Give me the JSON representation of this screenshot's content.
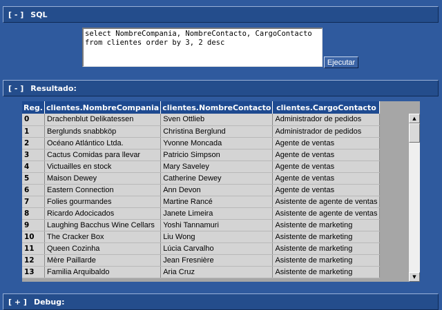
{
  "sql_section": {
    "toggle": "[ - ]",
    "title": "SQL",
    "query": "select NombreCompania, NombreContacto, CargoContacto\nfrom clientes order by 3, 2 desc",
    "execute_label": "Ejecutar"
  },
  "result_section": {
    "toggle": "[ - ]",
    "title": "Resultado:",
    "columns": [
      "Reg.",
      "clientes.NombreCompania",
      "clientes.NombreContacto",
      "clientes.CargoContacto"
    ],
    "rows": [
      [
        "0",
        "Drachenblut Delikatessen",
        "Sven Ottlieb",
        "Administrador de pedidos"
      ],
      [
        "1",
        "Berglunds snabbköp",
        "Christina Berglund",
        "Administrador de pedidos"
      ],
      [
        "2",
        "Océano Atlántico Ltda.",
        "Yvonne Moncada",
        "Agente de ventas"
      ],
      [
        "3",
        "Cactus Comidas para llevar",
        "Patricio Simpson",
        "Agente de ventas"
      ],
      [
        "4",
        "Victuailles en stock",
        "Mary Saveley",
        "Agente de ventas"
      ],
      [
        "5",
        "Maison Dewey",
        "Catherine Dewey",
        "Agente de ventas"
      ],
      [
        "6",
        "Eastern Connection",
        "Ann Devon",
        "Agente de ventas"
      ],
      [
        "7",
        "Folies gourmandes",
        "Martine Rancé",
        "Asistente de agente de ventas"
      ],
      [
        "8",
        "Ricardo Adocicados",
        "Janete Limeira",
        "Asistente de agente de ventas"
      ],
      [
        "9",
        "Laughing Bacchus Wine Cellars",
        "Yoshi Tannamuri",
        "Asistente de marketing"
      ],
      [
        "10",
        "The Cracker Box",
        "Liu Wong",
        "Asistente de marketing"
      ],
      [
        "11",
        "Queen Cozinha",
        "Lúcia Carvalho",
        "Asistente de marketing"
      ],
      [
        "12",
        "Mère Paillarde",
        "Jean Fresnière",
        "Asistente de marketing"
      ],
      [
        "13",
        "Familia Arquibaldo",
        "Aria Cruz",
        "Asistente de marketing"
      ]
    ]
  },
  "debug_section": {
    "toggle": "[ + ]",
    "title": "Debug:"
  },
  "scrollbar": {
    "up_icon": "▲",
    "down_icon": "▼"
  },
  "colors": {
    "background": "#2f5a9e",
    "header_bar": "#244d8c",
    "grid_header": "#1e4a90",
    "grid_cell": "#d4d4d4"
  }
}
